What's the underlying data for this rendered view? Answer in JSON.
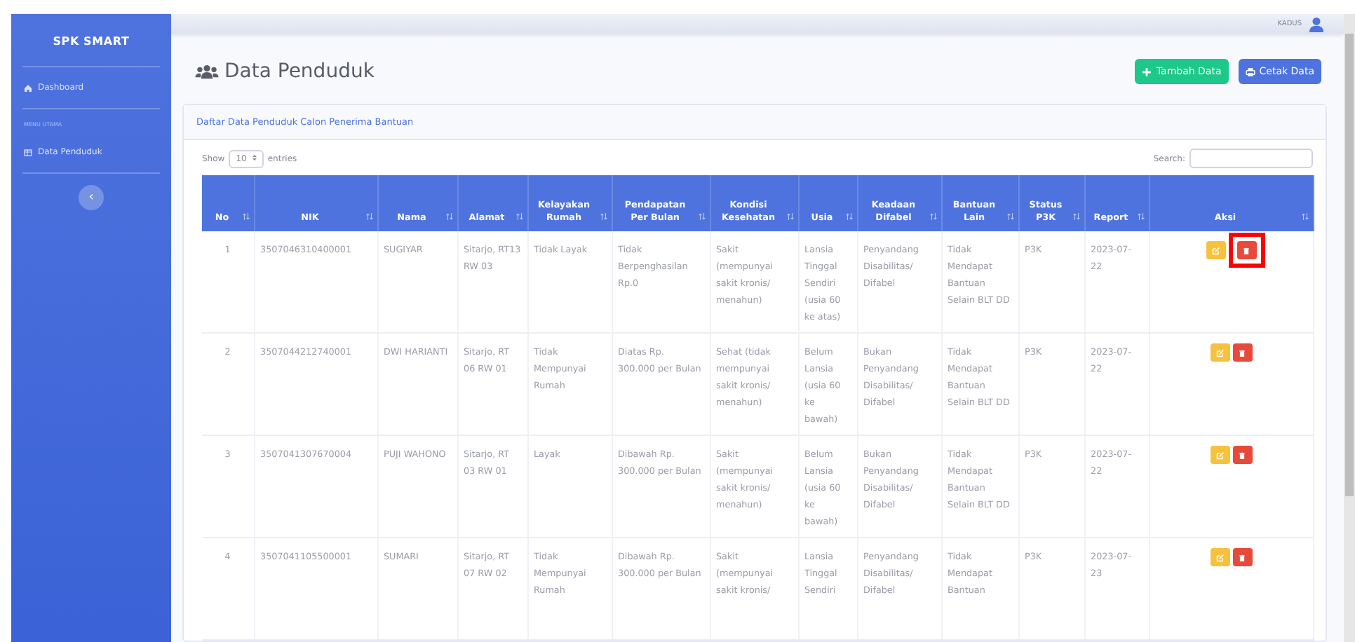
{
  "sidebar": {
    "brand": "SPK SMART",
    "items": [
      {
        "kind": "link",
        "label": "Dashboard"
      },
      {
        "kind": "heading",
        "label": "MENU UTAMA"
      },
      {
        "kind": "link",
        "label": "Data Penduduk"
      }
    ],
    "toggle": "‹"
  },
  "topbar": {
    "user": "KADUS"
  },
  "page": {
    "title": "Data Penduduk",
    "buttons": [
      {
        "kind": "add",
        "label": "Tambah Data"
      },
      {
        "kind": "print",
        "label": "Cetak Data"
      }
    ]
  },
  "card": {
    "title": "Daftar Data Penduduk Calon Penerima Bantuan",
    "show_label": "Show",
    "page_size": "10",
    "entries_label": "entries",
    "search_label": "Search:"
  },
  "table": {
    "columns": [
      "No",
      "NIK",
      "Nama",
      "Alamat",
      "Kelayakan Rumah",
      "Pendapatan Per Bulan",
      "Kondisi Kesehatan",
      "Usia",
      "Keadaan Difabel",
      "Bantuan Lain",
      "Status P3K",
      "Report",
      "Aksi"
    ],
    "rows": [
      {
        "cells": [
          "1",
          "3507046310400001",
          "SUGIYAR",
          "Sitarjo, RT13 RW 03",
          "Tidak Layak",
          "Tidak Berpenghasilan Rp.0",
          "Sakit (mempunyai sakit kronis/ menahun)",
          "Lansia Tinggal Sendiri (usia 60 ke atas)",
          "Penyandang Disabilitas/ Difabel",
          "Tidak Mendapat Bantuan Selain BLT DD",
          "P3K",
          "2023-07-22"
        ],
        "delete_highlighted": true
      },
      {
        "cells": [
          "2",
          "3507044212740001",
          "DWI HARIANTI",
          "Sitarjo, RT 06 RW 01",
          "Tidak Mempunyai Rumah",
          "Diatas Rp. 300.000 per Bulan",
          "Sehat (tidak mempunyai sakit kronis/ menahun)",
          "Belum Lansia (usia 60 ke bawah)",
          "Bukan Penyandang Disabilitas/ Difabel",
          "Tidak Mendapat Bantuan Selain BLT DD",
          "P3K",
          "2023-07-22"
        ],
        "delete_highlighted": false
      },
      {
        "cells": [
          "3",
          "3507041307670004",
          "PUJI WAHONO",
          "Sitarjo, RT 03 RW 01",
          "Layak",
          "Dibawah Rp. 300.000 per Bulan",
          "Sakit (mempunyai sakit kronis/ menahun)",
          "Belum Lansia (usia 60 ke bawah)",
          "Bukan Penyandang Disabilitas/ Difabel",
          "Tidak Mendapat Bantuan Selain BLT DD",
          "P3K",
          "2023-07-22"
        ],
        "delete_highlighted": false
      },
      {
        "cells": [
          "4",
          "3507041105500001",
          "SUMARI",
          "Sitarjo, RT 07 RW 02",
          "Tidak Mempunyai Rumah",
          "Dibawah Rp. 300.000 per Bulan",
          "Sakit (mempunyai sakit kronis/",
          "Lansia Tinggal Sendiri",
          "Penyandang Disabilitas/ Difabel",
          "Tidak Mendapat Bantuan",
          "P3K",
          "2023-07-23"
        ],
        "delete_highlighted": false
      }
    ]
  }
}
